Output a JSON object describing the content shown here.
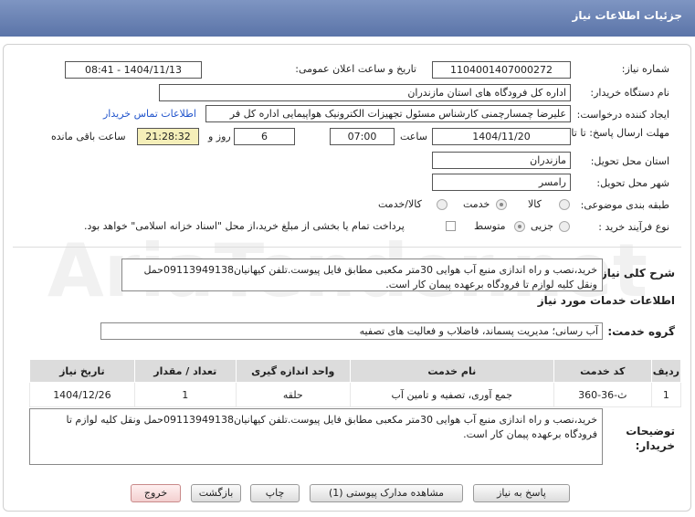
{
  "header": {
    "title": "جزئیات اطلاعات نیاز"
  },
  "watermark": "AriaTender.net",
  "fields": {
    "need_number_label": "شماره نیاز:",
    "need_number": "1104001407000272",
    "announce_label": "تاریخ و ساعت اعلان عمومی:",
    "announce_value": "1404/11/13 - 08:41",
    "buyer_org_label": "نام دستگاه خریدار:",
    "buyer_org": "اداره کل فرودگاه های استان مازندران",
    "creator_label": "ایجاد کننده درخواست:",
    "creator": "علیرضا چمسارچمنی کارشناس مسئول تجهیزات الکترونیک هواپیمایی اداره کل فر",
    "contact_link": "اطلاعات تماس خریدار",
    "deadline_label": "مهلت ارسال پاسخ: تا تاریخ:",
    "deadline_date": "1404/11/20",
    "time_label": "ساعت",
    "deadline_time": "07:00",
    "days": "6",
    "days_label": "روز و",
    "remaining": "21:28:32",
    "remaining_label": "ساعت باقی مانده",
    "province_label": "استان محل تحویل:",
    "province": "مازندران",
    "city_label": "شهر محل تحویل:",
    "city": "رامسر",
    "category_label": "طبقه بندی موضوعی:",
    "category_options": [
      "کالا/خدمت",
      "خدمت",
      "کالا"
    ],
    "category_selected": 1,
    "process_label": "نوع فرآیند خرید :",
    "process_options": [
      "متوسط",
      "جزیی"
    ],
    "process_note": "پرداخت تمام یا بخشی از مبلغ خرید،از محل \"اسناد خزانه اسلامی\" خواهد بود."
  },
  "summary": {
    "label": "شرح کلی نیاز:",
    "text": "خرید،نصب و راه اندازی منبع آب هوایی 30متر مکعبی مطابق فایل پیوست.تلفن کیهانیان09113949138حمل ونقل کلیه لوازم تا فرودگاه برعهده پیمان کار است."
  },
  "services": {
    "section_title": "اطلاعات خدمات مورد نیاز",
    "group_label": "گروه خدمت:",
    "group_value": "آب رسانی؛ مدیریت پسماند، فاضلاب و فعالیت های تصفیه",
    "columns": [
      "ردیف",
      "کد خدمت",
      "نام خدمت",
      "واحد اندازه گیری",
      "تعداد / مقدار",
      "تاریخ نیاز"
    ],
    "rows": [
      [
        "1",
        "ث-36-360",
        "جمع آوری، تصفیه و تامین آب",
        "حلقه",
        "1",
        "1404/12/26"
      ]
    ]
  },
  "buyer_notes": {
    "label": "توضیحات خریدار:",
    "text": "خرید،نصب و راه اندازی منبع آب هوایی 30متر مکعبی مطابق فایل پیوست.تلفن کیهانیان09113949138حمل ونقل کلیه لوازم تا فرودگاه برعهده پیمان کار است."
  },
  "buttons": {
    "reply": "پاسخ به نیاز",
    "attachments": "مشاهده مدارک پیوستی (1)",
    "print": "چاپ",
    "back": "بازگشت",
    "exit": "خروج"
  }
}
